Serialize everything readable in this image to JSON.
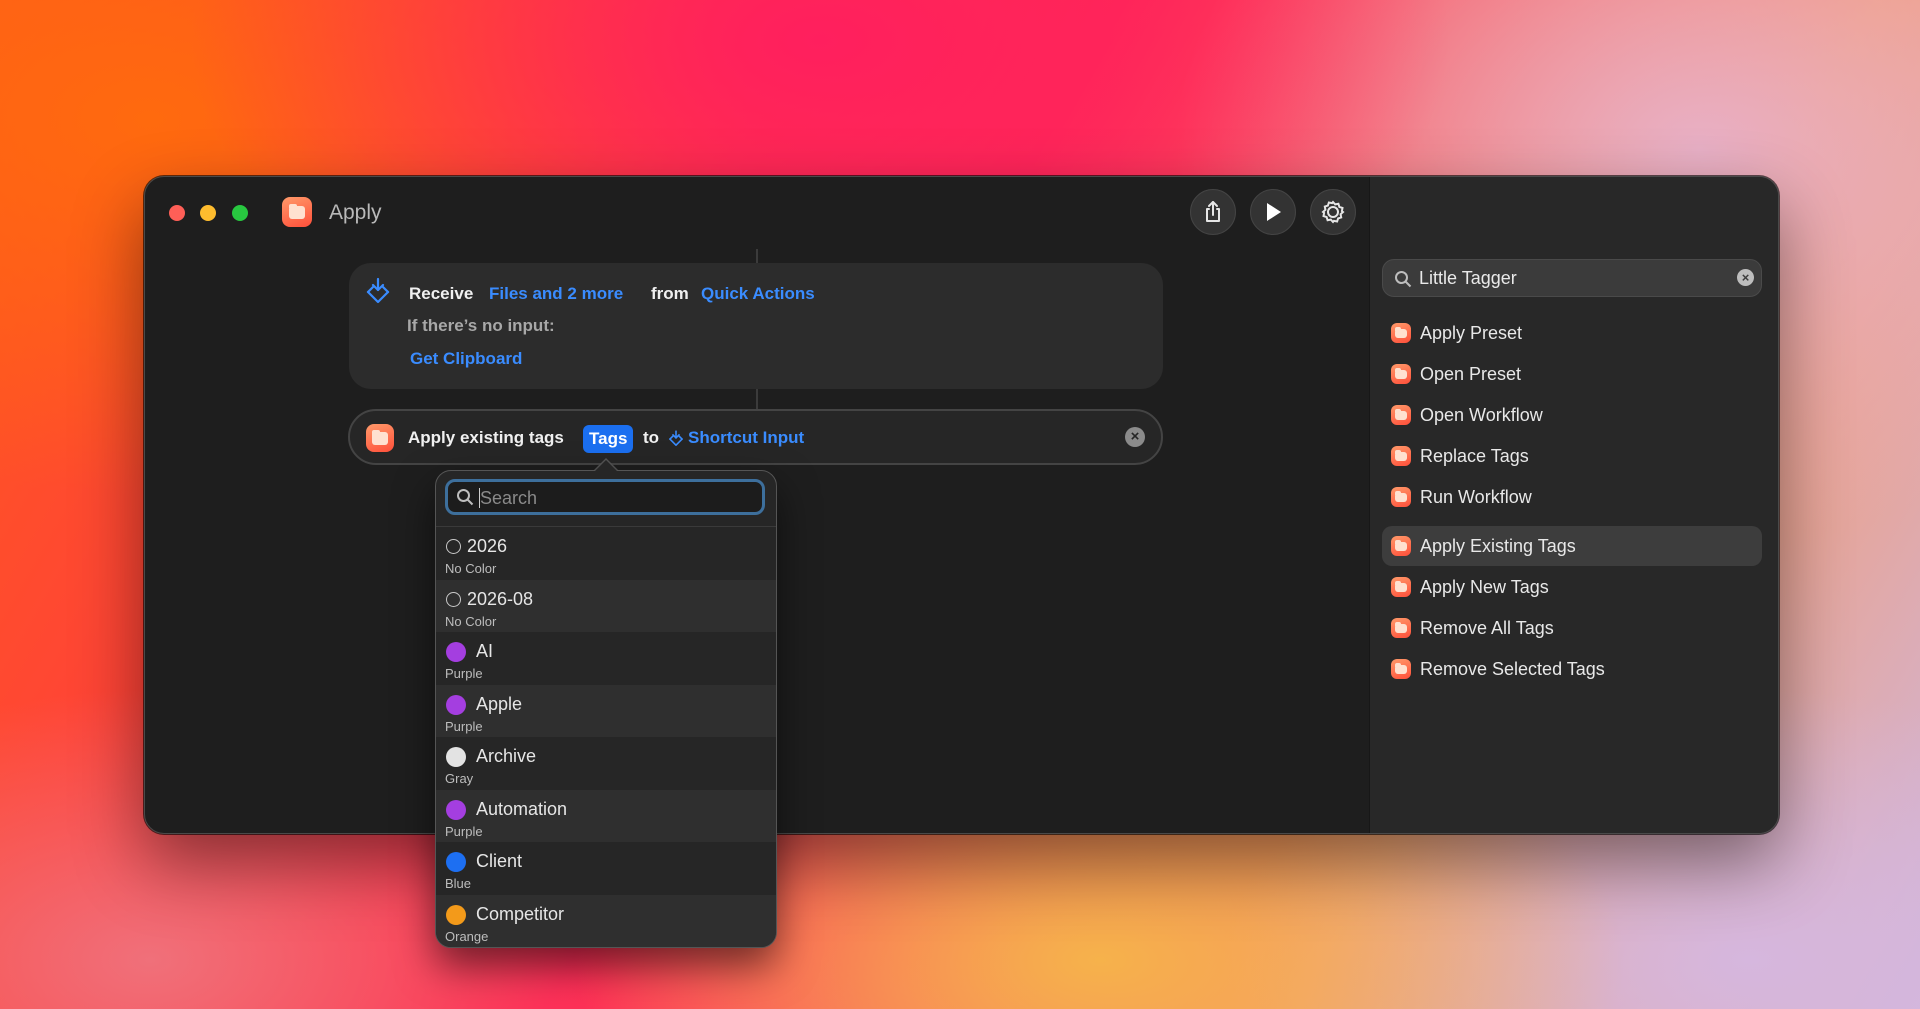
{
  "window": {
    "title": "Apply"
  },
  "toolbar": {
    "share_icon": "share-icon",
    "run_icon": "play-icon",
    "settings_icon": "gear-icon",
    "library_icon": "library-icon",
    "info_icon": "info-icon"
  },
  "receive": {
    "receive_label": "Receive",
    "types": "Files and 2 more",
    "from_label": "from",
    "source": "Quick Actions",
    "no_input_label": "If there’s no input:",
    "fallback": "Get Clipboard"
  },
  "action": {
    "label": "Apply existing tags",
    "tags_param": "Tags",
    "to_label": "to",
    "target": "Shortcut Input"
  },
  "popover": {
    "search_placeholder": "Search",
    "items": [
      {
        "name": "2026",
        "color": "No Color",
        "swatch": "none"
      },
      {
        "name": "2026-08",
        "color": "No Color",
        "swatch": "none"
      },
      {
        "name": "AI",
        "color": "Purple",
        "swatch": "#a43ee0"
      },
      {
        "name": "Apple",
        "color": "Purple",
        "swatch": "#a43ee0"
      },
      {
        "name": "Archive",
        "color": "Gray",
        "swatch": "#e3e3e3"
      },
      {
        "name": "Automation",
        "color": "Purple",
        "swatch": "#a43ee0"
      },
      {
        "name": "Client",
        "color": "Blue",
        "swatch": "#1d6ff2"
      },
      {
        "name": "Competitor",
        "color": "Orange",
        "swatch": "#f39a1a"
      }
    ]
  },
  "sidebar": {
    "search_value": "Little Tagger",
    "items": [
      {
        "label": "Apply Preset"
      },
      {
        "label": "Open Preset"
      },
      {
        "label": "Open Workflow"
      },
      {
        "label": "Replace Tags"
      },
      {
        "label": "Run Workflow"
      },
      {
        "label": "Apply Existing Tags",
        "selected": true
      },
      {
        "label": "Apply New Tags"
      },
      {
        "label": "Remove All Tags"
      },
      {
        "label": "Remove Selected Tags"
      }
    ]
  },
  "colors": {
    "accent": "#3a8cff",
    "window_bg": "#1e1e1e",
    "sidebar_bg": "#282828"
  }
}
